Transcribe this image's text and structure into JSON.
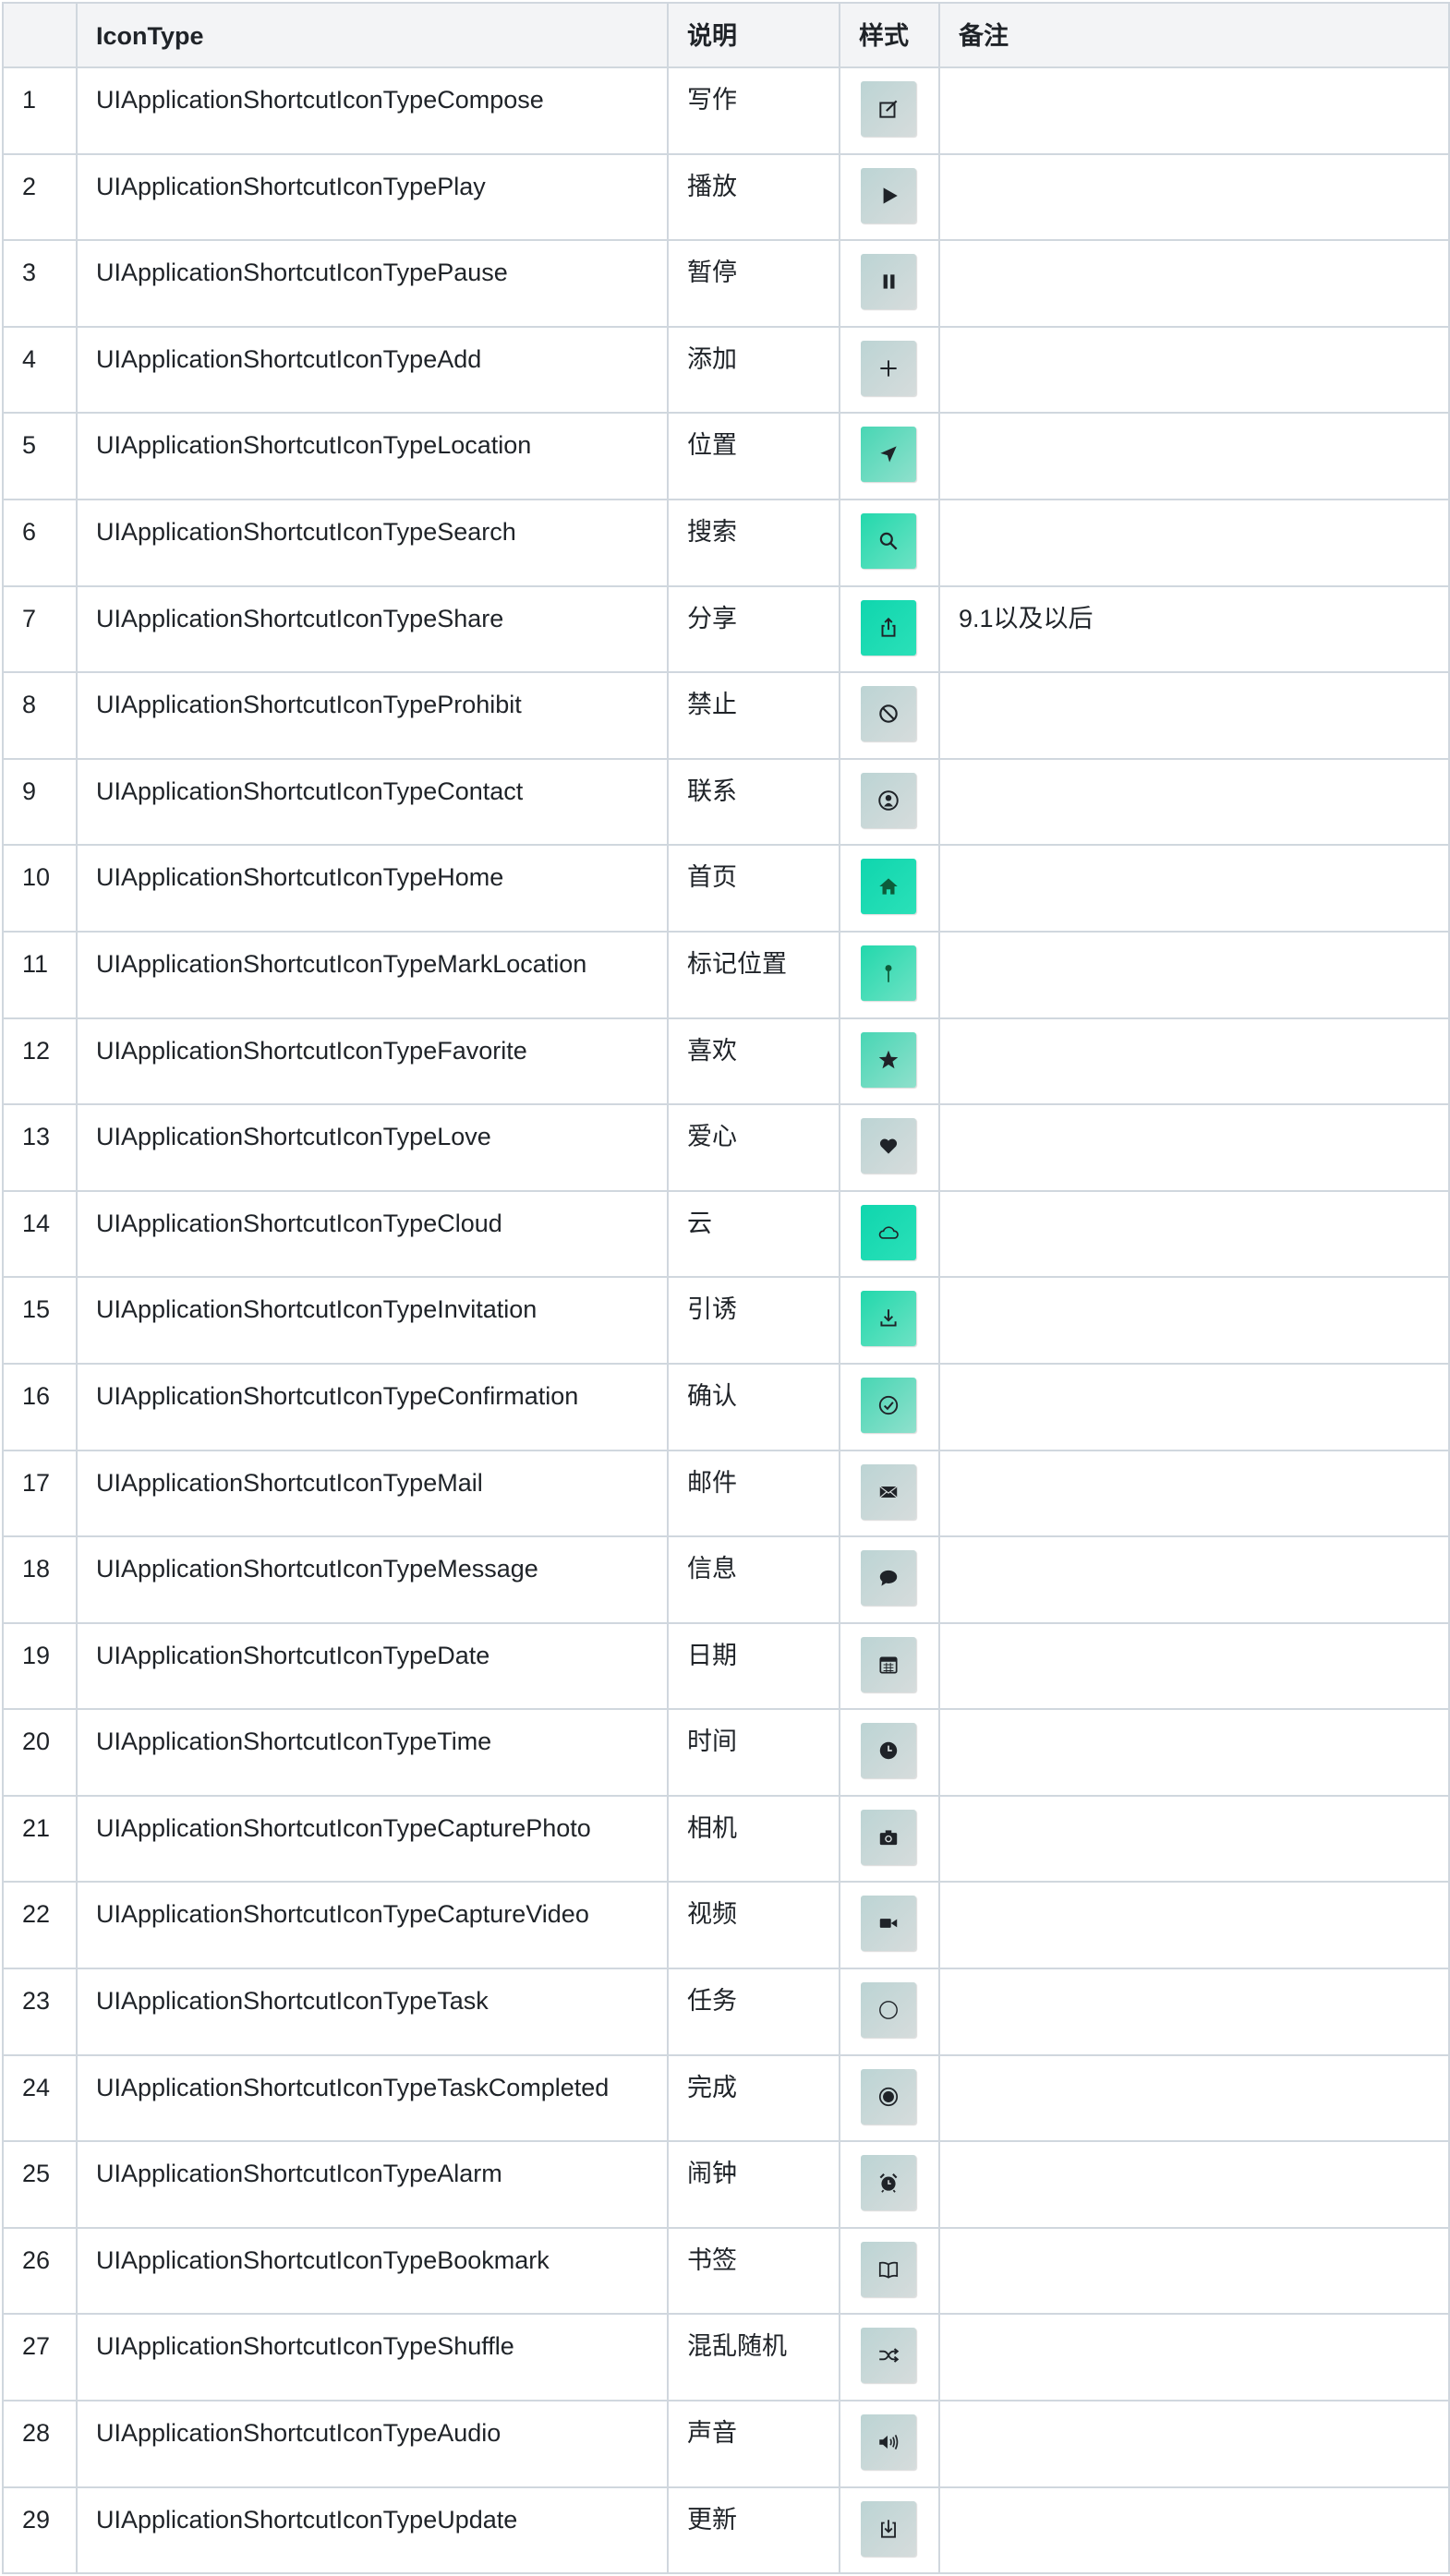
{
  "table": {
    "headers": {
      "num": "",
      "icon_type": "IconType",
      "desc": "说明",
      "style": "样式",
      "note": "备注"
    },
    "rows": [
      {
        "num": "1",
        "icon_type": "UIApplicationShortcutIconTypeCompose",
        "desc": "写作",
        "note": "",
        "icon": "compose-icon",
        "tile": "gray"
      },
      {
        "num": "2",
        "icon_type": "UIApplicationShortcutIconTypePlay",
        "desc": "播放",
        "note": "",
        "icon": "play-icon",
        "tile": "gray"
      },
      {
        "num": "3",
        "icon_type": "UIApplicationShortcutIconTypePause",
        "desc": "暂停",
        "note": "",
        "icon": "pause-icon",
        "tile": "gray"
      },
      {
        "num": "4",
        "icon_type": " UIApplicationShortcutIconTypeAdd",
        "desc": "添加",
        "note": "",
        "icon": "add-icon",
        "tile": "gray"
      },
      {
        "num": "5",
        "icon_type": "UIApplicationShortcutIconTypeLocation",
        "desc": "位置",
        "note": "",
        "icon": "location-icon",
        "tile": "mint"
      },
      {
        "num": "6",
        "icon_type": "UIApplicationShortcutIconTypeSearch",
        "desc": "搜索",
        "note": "",
        "icon": "search-icon",
        "tile": "green"
      },
      {
        "num": "7",
        "icon_type": "UIApplicationShortcutIconTypeShare",
        "desc": "分享",
        "note": "9.1以及以后",
        "icon": "share-icon",
        "tile": "teal"
      },
      {
        "num": "8",
        "icon_type": "UIApplicationShortcutIconTypeProhibit",
        "desc": "禁止",
        "note": "",
        "icon": "prohibit-icon",
        "tile": "gray"
      },
      {
        "num": "9",
        "icon_type": "UIApplicationShortcutIconTypeContact",
        "desc": "联系",
        "note": "",
        "icon": "contact-icon",
        "tile": "gray"
      },
      {
        "num": "10",
        "icon_type": "UIApplicationShortcutIconTypeHome",
        "desc": "首页",
        "note": "",
        "icon": "home-icon",
        "tile": "teal"
      },
      {
        "num": "11",
        "icon_type": "UIApplicationShortcutIconTypeMarkLocation",
        "desc": "标记位置",
        "note": "",
        "icon": "mark-location-icon",
        "tile": "green"
      },
      {
        "num": "12",
        "icon_type": "UIApplicationShortcutIconTypeFavorite",
        "desc": "喜欢",
        "note": "",
        "icon": "favorite-icon",
        "tile": "mint"
      },
      {
        "num": "13",
        "icon_type": "UIApplicationShortcutIconTypeLove",
        "desc": "爱心",
        "note": "",
        "icon": "love-icon",
        "tile": "gray"
      },
      {
        "num": "14",
        "icon_type": "UIApplicationShortcutIconTypeCloud",
        "desc": "云",
        "note": "",
        "icon": "cloud-icon",
        "tile": "teal"
      },
      {
        "num": "15",
        "icon_type": "UIApplicationShortcutIconTypeInvitation",
        "desc": "引诱",
        "note": "",
        "icon": "invitation-icon",
        "tile": "green"
      },
      {
        "num": "16",
        "icon_type": "UIApplicationShortcutIconTypeConfirmation",
        "desc": "确认",
        "note": "",
        "icon": "confirmation-icon",
        "tile": "mint"
      },
      {
        "num": "17",
        "icon_type": "UIApplicationShortcutIconTypeMail",
        "desc": "邮件",
        "note": "",
        "icon": "mail-icon",
        "tile": "gray"
      },
      {
        "num": "18",
        "icon_type": "UIApplicationShortcutIconTypeMessage",
        "desc": "信息",
        "note": "",
        "icon": "message-icon",
        "tile": "gray"
      },
      {
        "num": "19",
        "icon_type": "UIApplicationShortcutIconTypeDate",
        "desc": "日期",
        "note": "",
        "icon": "date-icon",
        "tile": "gray"
      },
      {
        "num": "20",
        "icon_type": "UIApplicationShortcutIconTypeTime",
        "desc": "时间",
        "note": "",
        "icon": "time-icon",
        "tile": "gray"
      },
      {
        "num": "21",
        "icon_type": "UIApplicationShortcutIconTypeCapturePhoto",
        "desc": "相机",
        "note": "",
        "icon": "capture-photo-icon",
        "tile": "gray"
      },
      {
        "num": "22",
        "icon_type": "UIApplicationShortcutIconTypeCaptureVideo",
        "desc": "视频",
        "note": "",
        "icon": "capture-video-icon",
        "tile": "gray"
      },
      {
        "num": "23",
        "icon_type": "UIApplicationShortcutIconTypeTask",
        "desc": "任务",
        "note": "",
        "icon": "task-icon",
        "tile": "gray"
      },
      {
        "num": "24",
        "icon_type": "UIApplicationShortcutIconTypeTaskCompleted",
        "desc": "完成",
        "note": "",
        "icon": "task-completed-icon",
        "tile": "gray"
      },
      {
        "num": "25",
        "icon_type": "UIApplicationShortcutIconTypeAlarm",
        "desc": "闹钟",
        "note": "",
        "icon": "alarm-icon",
        "tile": "gray"
      },
      {
        "num": "26",
        "icon_type": "UIApplicationShortcutIconTypeBookmark",
        "desc": "书签",
        "note": "",
        "icon": "bookmark-icon",
        "tile": "gray"
      },
      {
        "num": "27",
        "icon_type": "UIApplicationShortcutIconTypeShuffle",
        "desc": "混乱随机",
        "note": "",
        "icon": "shuffle-icon",
        "tile": "gray"
      },
      {
        "num": "28",
        "icon_type": "UIApplicationShortcutIconTypeAudio",
        "desc": "声音",
        "note": "",
        "icon": "audio-icon",
        "tile": "gray"
      },
      {
        "num": "29",
        "icon_type": "UIApplicationShortcutIconTypeUpdate",
        "desc": "更新",
        "note": "",
        "icon": "update-icon",
        "tile": "gray"
      }
    ]
  }
}
